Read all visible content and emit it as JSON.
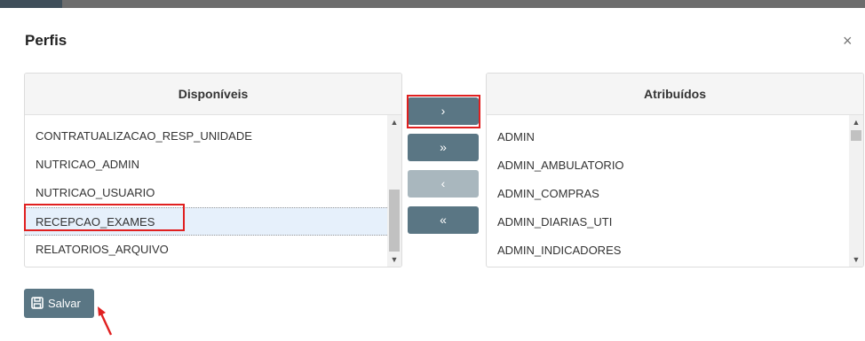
{
  "modal": {
    "title": "Perfis",
    "close_glyph": "×"
  },
  "available": {
    "header": "Disponíveis",
    "items": [
      "CONTRATUALIZACAO_RESP_UNIDADE",
      "NUTRICAO_ADMIN",
      "NUTRICAO_USUARIO",
      "RECEPCAO_EXAMES",
      "RELATORIOS_ARQUIVO"
    ],
    "selected_item": "RECEPCAO_EXAMES"
  },
  "assigned": {
    "header": "Atribuídos",
    "items": [
      "ADMIN",
      "ADMIN_AMBULATORIO",
      "ADMIN_COMPRAS",
      "ADMIN_DIARIAS_UTI",
      "ADMIN_INDICADORES"
    ]
  },
  "transfer_buttons": {
    "move_one": "›",
    "move_all": "»",
    "remove_one": "‹",
    "remove_all": "«"
  },
  "save_button": {
    "label": "Salvar",
    "icon": "floppy-disk-icon"
  },
  "colors": {
    "button": "#5a7684",
    "button_disabled": "#a9b7be",
    "highlight": "#e02020",
    "selected_row": "#e6f0fb"
  }
}
